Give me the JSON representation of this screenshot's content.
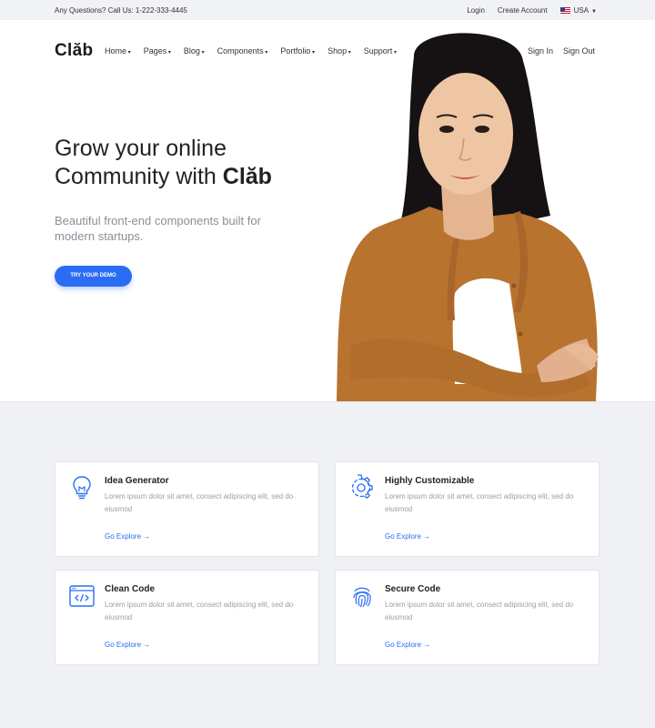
{
  "topbar": {
    "contact": "Any Questions? Call Us: 1-222-333-4445",
    "login": "Login",
    "create_account": "Create Account",
    "country": "USA"
  },
  "header": {
    "logo": "Clăb",
    "nav": [
      "Home",
      "Pages",
      "Blog",
      "Components",
      "Portfolio",
      "Shop",
      "Support"
    ],
    "sign_in": "Sign In",
    "sign_out": "Sign Out"
  },
  "hero": {
    "headline_line1": "Grow your online",
    "headline_line2_prefix": "Community with ",
    "headline_brand": "Clăb",
    "subheadline": "Beautiful front-end components built for modern startups.",
    "cta": "TRY YOUR DEMO"
  },
  "features": [
    {
      "title": "Idea Generator",
      "desc": "Lorem ipsum dolor sit amet, consect adipiscing elit, sed do eiusmod",
      "link": "Go Explore",
      "icon": "lightbulb-icon"
    },
    {
      "title": "Highly Customizable",
      "desc": "Lorem ipsum dolor sit amet, consect adipiscing elit, sed do eiusmod",
      "link": "Go Explore",
      "icon": "gear-icon"
    },
    {
      "title": "Clean Code",
      "desc": "Lorem ipsum dolor sit amet, consect adipiscing elit, sed do eiusmod",
      "link": "Go Explore",
      "icon": "code-window-icon"
    },
    {
      "title": "Secure Code",
      "desc": "Lorem ipsum dolor sit amet, consect adipiscing elit, sed do eiusmod",
      "link": "Go Explore",
      "icon": "fingerprint-icon"
    }
  ],
  "colors": {
    "accent": "#2a6df4",
    "hero_bg": "#ffffff",
    "page_bg": "#f1f2f6"
  }
}
